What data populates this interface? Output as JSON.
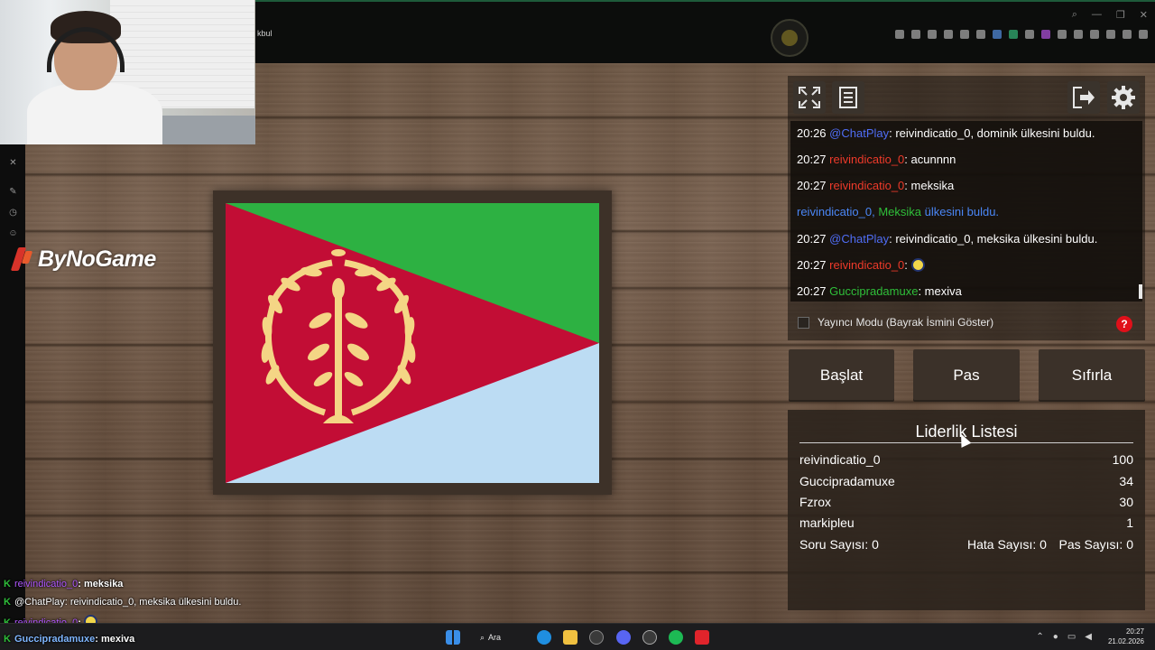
{
  "topbar": {
    "partial_text": "kbul"
  },
  "brand": {
    "logo_text": "ByNoGame"
  },
  "flag": {
    "colors": {
      "green": "#2db142",
      "red": "#c20d35",
      "blue": "#bcdcf3",
      "emblem": "#f4d585"
    }
  },
  "chat": {
    "lines": [
      {
        "time": "20:26",
        "user": "@ChatPlay",
        "message": ": reivindicatio_0, dominik ülkesini buldu."
      },
      {
        "time": "20:27",
        "user": "reivindicatio_0",
        "message": ": acunnnn"
      },
      {
        "time": "20:27",
        "user": "reivindicatio_0",
        "message": ": meksika"
      },
      {
        "system_user": "reivindicatio_0,",
        "system_country": "Meksika",
        "system_rest": "ülkesini buldu."
      },
      {
        "time": "20:27",
        "user": "@ChatPlay",
        "message": ": reivindicatio_0, meksika ülkesini buldu."
      },
      {
        "time": "20:27",
        "user": "reivindicatio_0",
        "message": ":"
      },
      {
        "time": "20:27",
        "user": "Guccipradamuxe",
        "message": ": mexiva"
      }
    ]
  },
  "mode": {
    "label": "Yayıncı Modu (Bayrak İsmini Göster)",
    "help": "?"
  },
  "actions": {
    "start": "Başlat",
    "pass": "Pas",
    "reset": "Sıfırla"
  },
  "leaderboard": {
    "title": "Liderlik Listesi",
    "rows": [
      {
        "name": "reivindicatio_0",
        "score": "100"
      },
      {
        "name": "Guccipradamuxe",
        "score": "34"
      },
      {
        "name": "Fzrox",
        "score": "30"
      },
      {
        "name": "markipleu",
        "score": "1"
      }
    ],
    "stats": {
      "questions": "Soru Sayısı: 0",
      "errors": "Hata Sayısı: 0",
      "passes": "Pas Sayısı: 0"
    }
  },
  "overlay_chat": [
    {
      "user": "reivindicatio_0",
      "message": ": meksika"
    },
    {
      "user": "@ChatPlay",
      "message": ": reivindicatio_0, meksika ülkesini buldu."
    },
    {
      "user": "reivindicatio_0",
      "message": ":"
    },
    {
      "user": "Guccipradamuxe",
      "message": ": mexiva"
    }
  ],
  "taskbar": {
    "search": "Ara",
    "time": "20:27",
    "date": "21.02.2026"
  }
}
